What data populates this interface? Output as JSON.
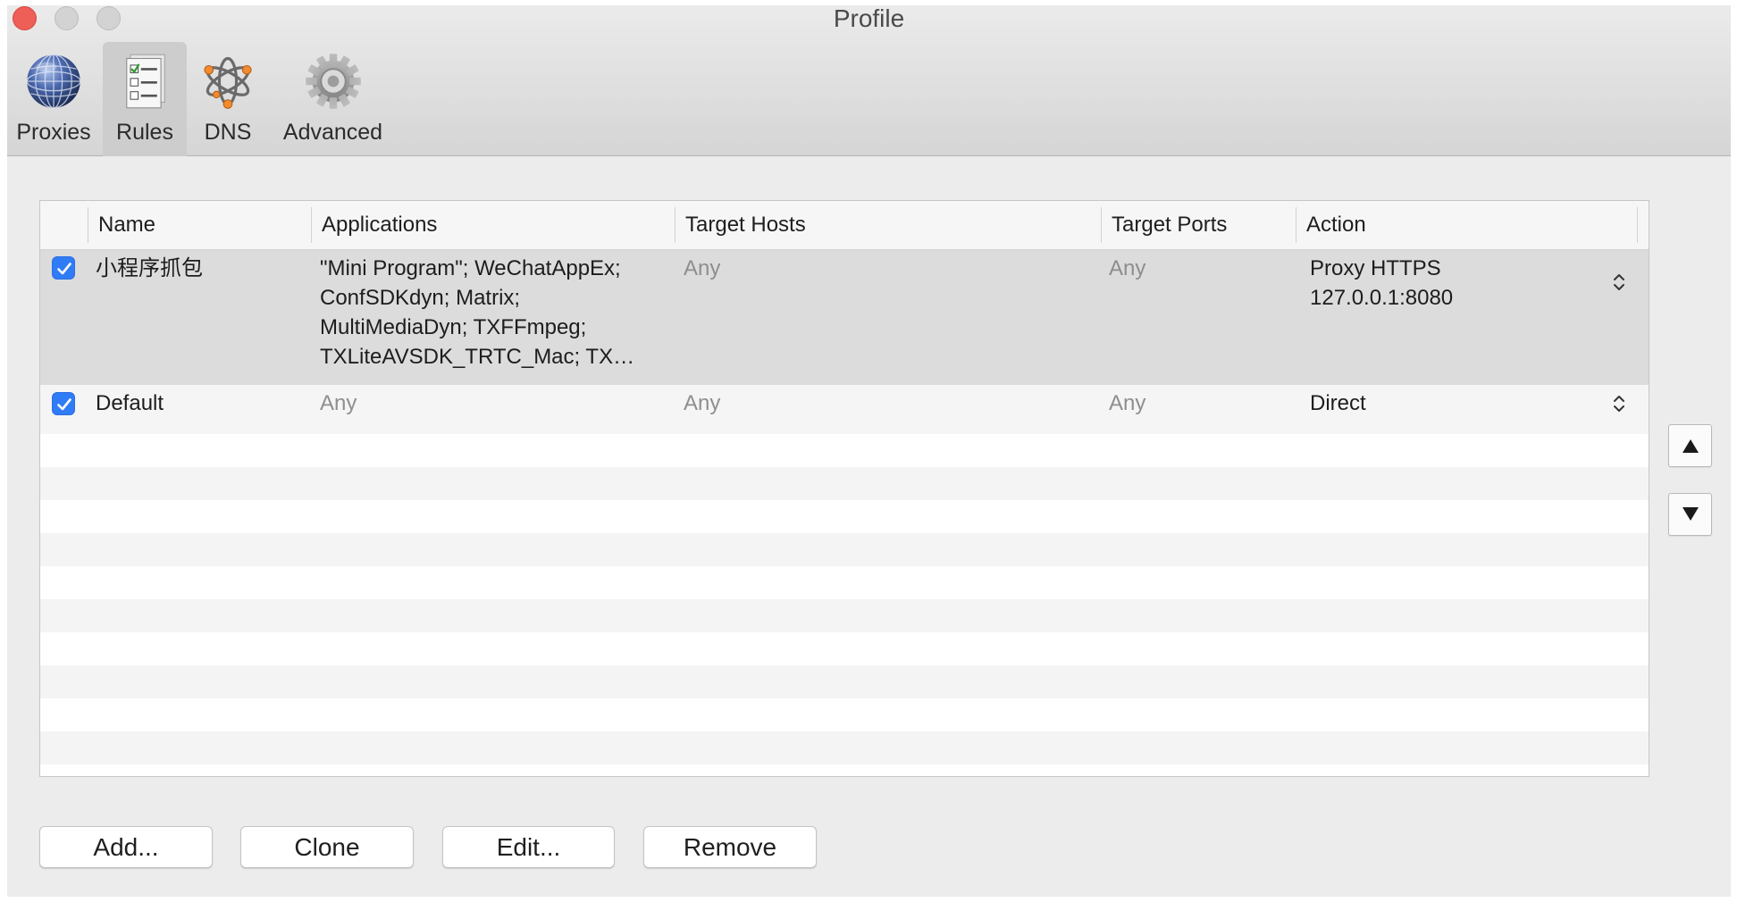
{
  "window": {
    "title": "Profile"
  },
  "toolbar": {
    "items": [
      {
        "label": "Proxies",
        "icon": "globe-icon",
        "selected": false
      },
      {
        "label": "Rules",
        "icon": "rules-checklist-icon",
        "selected": true
      },
      {
        "label": "DNS",
        "icon": "dns-network-icon",
        "selected": false
      },
      {
        "label": "Advanced",
        "icon": "gear-icon",
        "selected": false
      }
    ]
  },
  "rules_table": {
    "columns": [
      "Name",
      "Applications",
      "Target Hosts",
      "Target Ports",
      "Action"
    ],
    "rows": [
      {
        "enabled": true,
        "selected": true,
        "name": "小程序抓包",
        "applications": [
          "\"Mini Program\"; WeChatAppEx;",
          "ConfSDKdyn; Matrix;",
          "MultiMediaDyn; TXFFmpeg;",
          "TXLiteAVSDK_TRTC_Mac; TX…"
        ],
        "target_hosts": "Any",
        "target_ports": "Any",
        "action": [
          "Proxy HTTPS",
          "127.0.0.1:8080"
        ]
      },
      {
        "enabled": true,
        "selected": false,
        "name": "Default",
        "applications": [
          "Any"
        ],
        "target_hosts": "Any",
        "target_ports": "Any",
        "action": [
          "Direct"
        ]
      }
    ]
  },
  "reorder": {
    "up_icon": "triangle-up-icon",
    "down_icon": "triangle-down-icon"
  },
  "buttons": {
    "add": "Add...",
    "clone": "Clone",
    "edit": "Edit...",
    "remove": "Remove"
  },
  "colors": {
    "checkbox_accent": "#2f7cf6",
    "close_button": "#ee5f57",
    "selected_row": "#dcdcdc",
    "muted_text": "#8e8e8e"
  }
}
